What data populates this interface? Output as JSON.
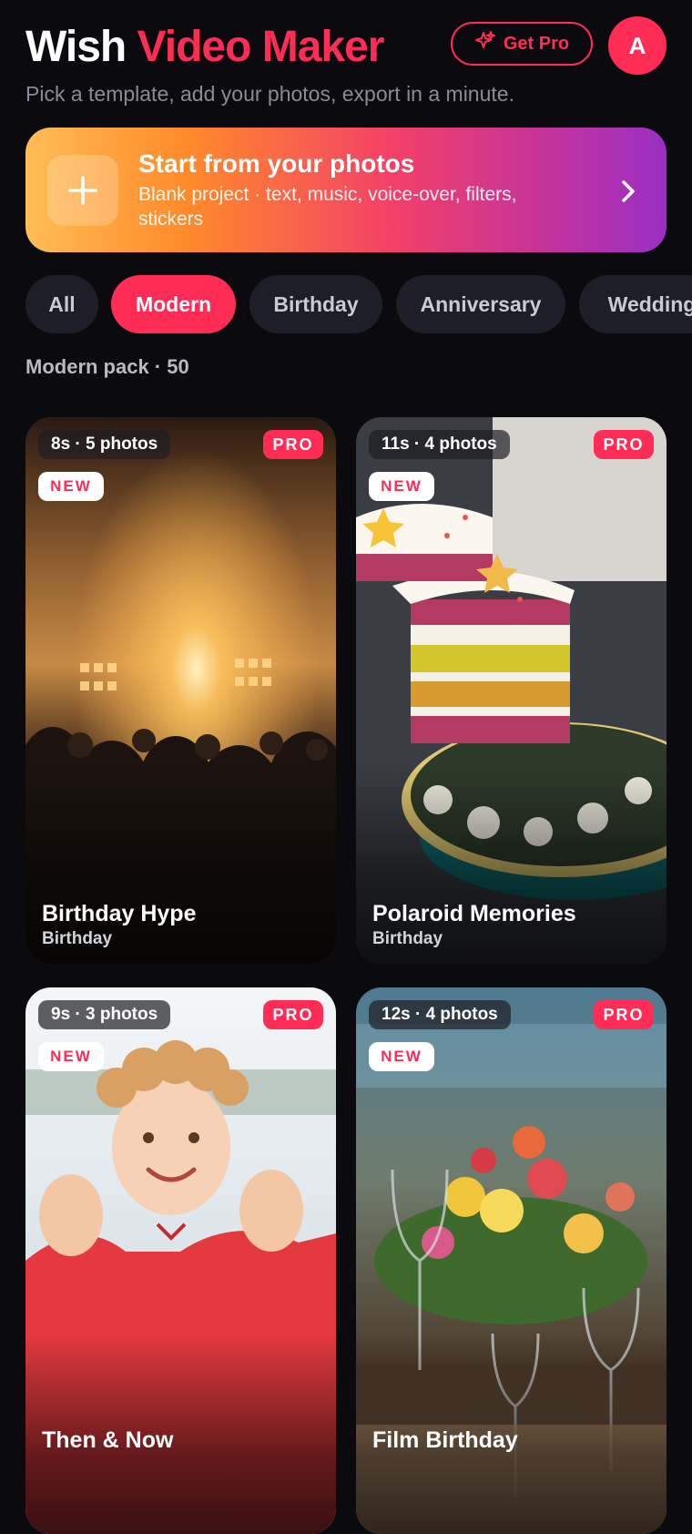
{
  "header": {
    "title_part1": "Wish",
    "title_part2": "Video Maker",
    "subtitle": "Pick a template, add your photos, export in a minute.",
    "get_pro_label": "Get Pro",
    "avatar_initial": "A"
  },
  "banner": {
    "title": "Start from your photos",
    "description": "Blank project · text, music, voice-over, filters, stickers"
  },
  "chips": [
    {
      "label": "All",
      "active": false
    },
    {
      "label": "Modern",
      "active": true
    },
    {
      "label": "Birthday",
      "active": false
    },
    {
      "label": "Anniversary",
      "active": false
    },
    {
      "label": "Wedding",
      "active": false
    }
  ],
  "pack_label": "Modern pack · 50",
  "templates": [
    {
      "duration": "8s · 5 photos",
      "pro": "PRO",
      "badge": "NEW",
      "name": "Birthday Hype",
      "category": "Birthday",
      "icon": "concert-photo"
    },
    {
      "duration": "11s · 4 photos",
      "pro": "PRO",
      "badge": "NEW",
      "name": "Polaroid Memories",
      "category": "Birthday",
      "icon": "cake-photo"
    },
    {
      "duration": "9s · 3 photos",
      "pro": "PRO",
      "badge": "NEW",
      "name": "Then & Now",
      "category": "",
      "icon": "child-photo"
    },
    {
      "duration": "12s · 4 photos",
      "pro": "PRO",
      "badge": "NEW",
      "name": "Film Birthday",
      "category": "",
      "icon": "flowers-table-photo"
    }
  ],
  "colors": {
    "accent": "#ff2d55",
    "background": "#0b0b0f",
    "chip": "#1d1e27"
  }
}
